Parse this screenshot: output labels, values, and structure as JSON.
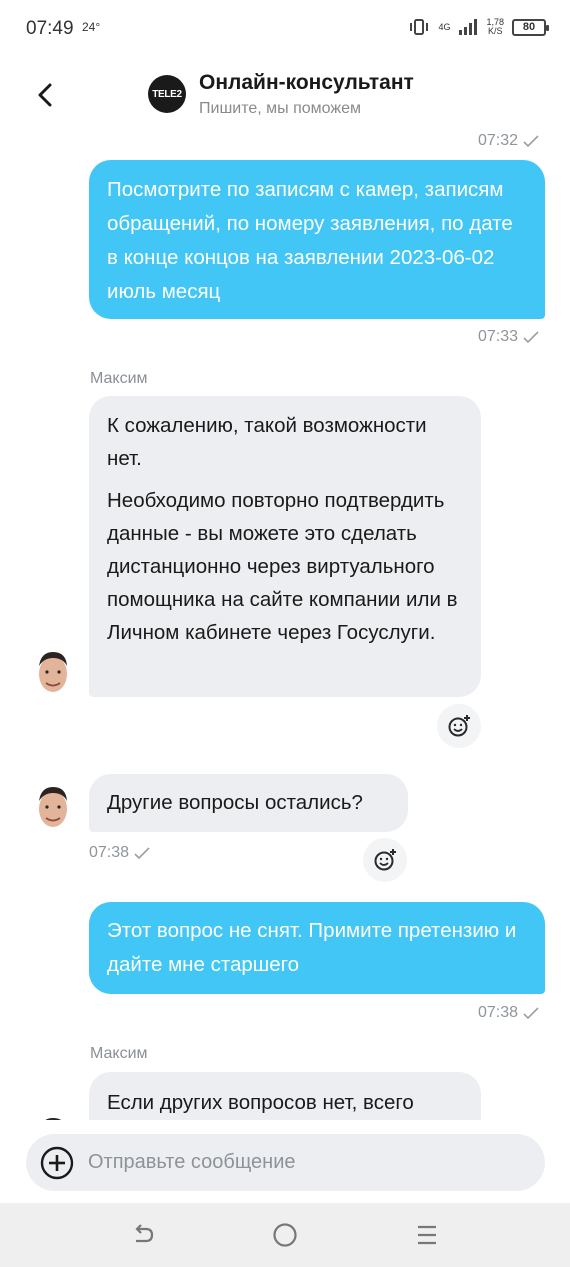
{
  "status_bar": {
    "time": "07:49",
    "temperature": "24°",
    "network": "4G",
    "speed_value": "1,78",
    "speed_unit": "K/S",
    "battery": "80"
  },
  "header": {
    "logo_text": "TELE2",
    "title": "Онлайн-консультант",
    "subtitle": "Пишите, мы поможем"
  },
  "messages": [
    {
      "type": "outgoing",
      "time": "07:32",
      "text": "Посмотрите по записям с камер, записям обращений, по номеру заявления, по дате в конце концов на заявлении 2023-06-02 июль месяц"
    },
    {
      "type": "outgoing_time",
      "time": "07:33"
    },
    {
      "type": "incoming",
      "sender": "Максим",
      "paragraphs": [
        "К сожалению, такой возможности нет.",
        "Необходимо повторно подтвердить данные - вы можете это сделать дистанционно через виртуального помощника на сайте компании или в Личном кабинете через Госуслуги."
      ]
    },
    {
      "type": "incoming",
      "text": "Другие вопросы остались?",
      "time": "07:38"
    },
    {
      "type": "outgoing",
      "text": "Этот вопрос не снят. Примите претензию  и дайте мне старшего",
      "time": "07:38"
    },
    {
      "type": "incoming",
      "sender": "Максим",
      "text": "Если других вопросов нет, всего"
    }
  ],
  "composer": {
    "placeholder": "Отправьте сообщение"
  },
  "colors": {
    "outgoing_bubble": "#41c6f5",
    "incoming_bubble": "#eceef1",
    "logo": "#1a1a1a"
  }
}
